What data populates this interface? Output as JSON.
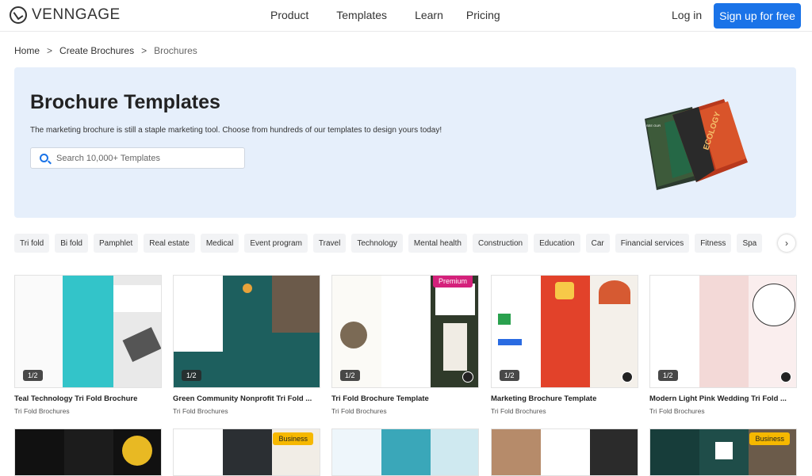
{
  "header": {
    "logo_text": "VENNGAGE",
    "nav": [
      "Product",
      "Templates",
      "Learn",
      "Pricing"
    ],
    "login": "Log in",
    "signup": "Sign up for free"
  },
  "breadcrumb": {
    "home": "Home",
    "parent": "Create Brochures",
    "current": "Brochures",
    "sep": ">"
  },
  "hero": {
    "title": "Brochure Templates",
    "description": "The marketing brochure is still a staple marketing tool. Choose from hundreds of our templates to design yours today!",
    "search_placeholder": "Search 10,000+ Templates"
  },
  "categories": [
    "Tri fold",
    "Bi fold",
    "Pamphlet",
    "Real estate",
    "Medical",
    "Event program",
    "Travel",
    "Technology",
    "Mental health",
    "Construction",
    "Education",
    "Car",
    "Financial services",
    "Fitness",
    "Spa"
  ],
  "cards": [
    {
      "title": "Teal Technology Tri Fold Brochure",
      "subtitle": "Tri Fold Brochures",
      "pager": "1/2",
      "badge": ""
    },
    {
      "title": "Green Community Nonprofit Tri Fold ...",
      "subtitle": "Tri Fold Brochures",
      "pager": "1/2",
      "badge": ""
    },
    {
      "title": "Tri Fold Brochure Template",
      "subtitle": "Tri Fold Brochures",
      "pager": "1/2",
      "badge": "Premium"
    },
    {
      "title": "Marketing Brochure Template",
      "subtitle": "Tri Fold Brochures",
      "pager": "1/2",
      "badge": ""
    },
    {
      "title": "Modern Light Pink Wedding Tri Fold ...",
      "subtitle": "Tri Fold Brochures",
      "pager": "1/2",
      "badge": ""
    }
  ],
  "row2_badges": [
    "",
    "Business",
    "",
    "",
    "Business"
  ],
  "colors": {
    "accent": "#1a73e8",
    "premium": "#d4217b",
    "business": "#f6b800",
    "hero_bg": "#e6effb"
  }
}
